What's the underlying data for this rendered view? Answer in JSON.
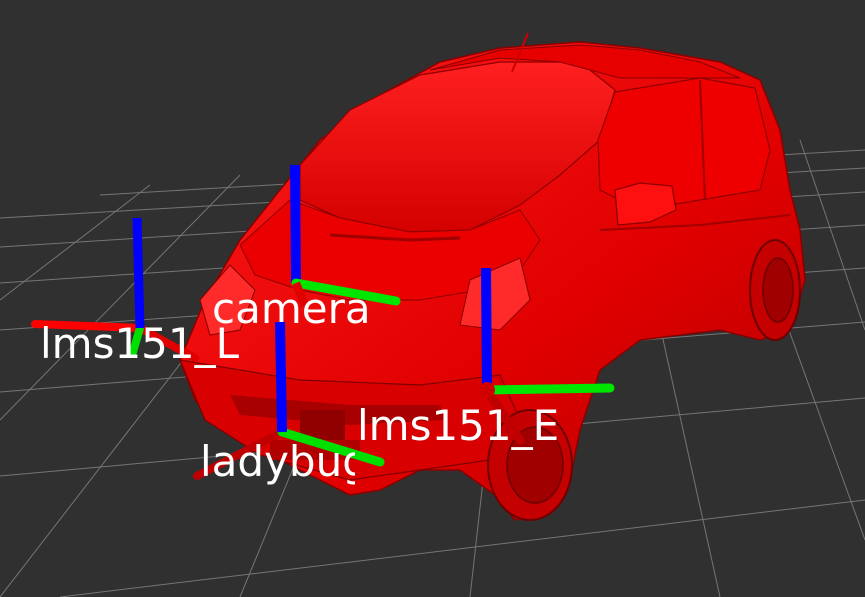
{
  "viewport": {
    "background": "#303030",
    "grid_color": "#8c8c8c",
    "model_color": "#ff0000",
    "axis_colors": {
      "x": "#ff0000",
      "y": "#00ff00",
      "z": "#0000ff"
    }
  },
  "frames": [
    {
      "id": "lms151_l",
      "label": "lms151_L"
    },
    {
      "id": "camera",
      "label": "camera"
    },
    {
      "id": "ladybug",
      "label": "ladybug"
    },
    {
      "id": "lms151_e",
      "label": "lms151_E"
    }
  ]
}
